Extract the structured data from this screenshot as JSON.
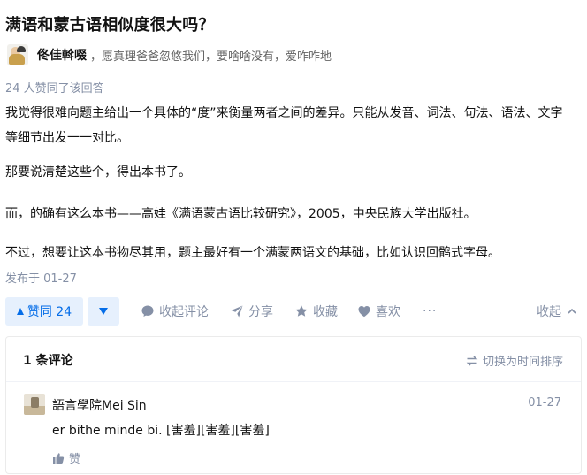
{
  "question": {
    "title": "满语和蒙古语相似度很大吗？"
  },
  "author": {
    "name": "佟佳斡啜",
    "bio": "，愿真理爸爸忽悠我们，要啥啥没有，爱咋咋地"
  },
  "answer": {
    "voters_text": "24 人赞同了该回答",
    "paragraphs": [
      "我觉得很难向题主给出一个具体的“度”来衡量两者之间的差异。只能从发音、词法、句法、语法、文字等细节出发一一对比。",
      "那要说清楚这些个，得出本书了。",
      "而，的确有这么本书——高娃《满语蒙古语比较研究》，2005，中央民族大学出版社。",
      "不过，想要让这本书物尽其用，题主最好有一个满蒙两语文的基础，比如认识回鹘式字母。"
    ],
    "published": "发布于 01-27"
  },
  "actions": {
    "vote_up": "赞同 24",
    "comment": "收起评论",
    "share": "分享",
    "favorite": "收藏",
    "like": "喜欢",
    "more": "···",
    "collapse": "收起"
  },
  "comments": {
    "count_label": "1 条评论",
    "sort_label": "切换为时间排序",
    "items": [
      {
        "author": "語言學院Mei Sin",
        "time": "01-27",
        "text": "er bithe minde bi. [害羞][害羞][害羞]",
        "like_label": "赞"
      }
    ]
  },
  "colors": {
    "accent": "#056de8",
    "muted": "#8590a6",
    "text": "#121212"
  }
}
